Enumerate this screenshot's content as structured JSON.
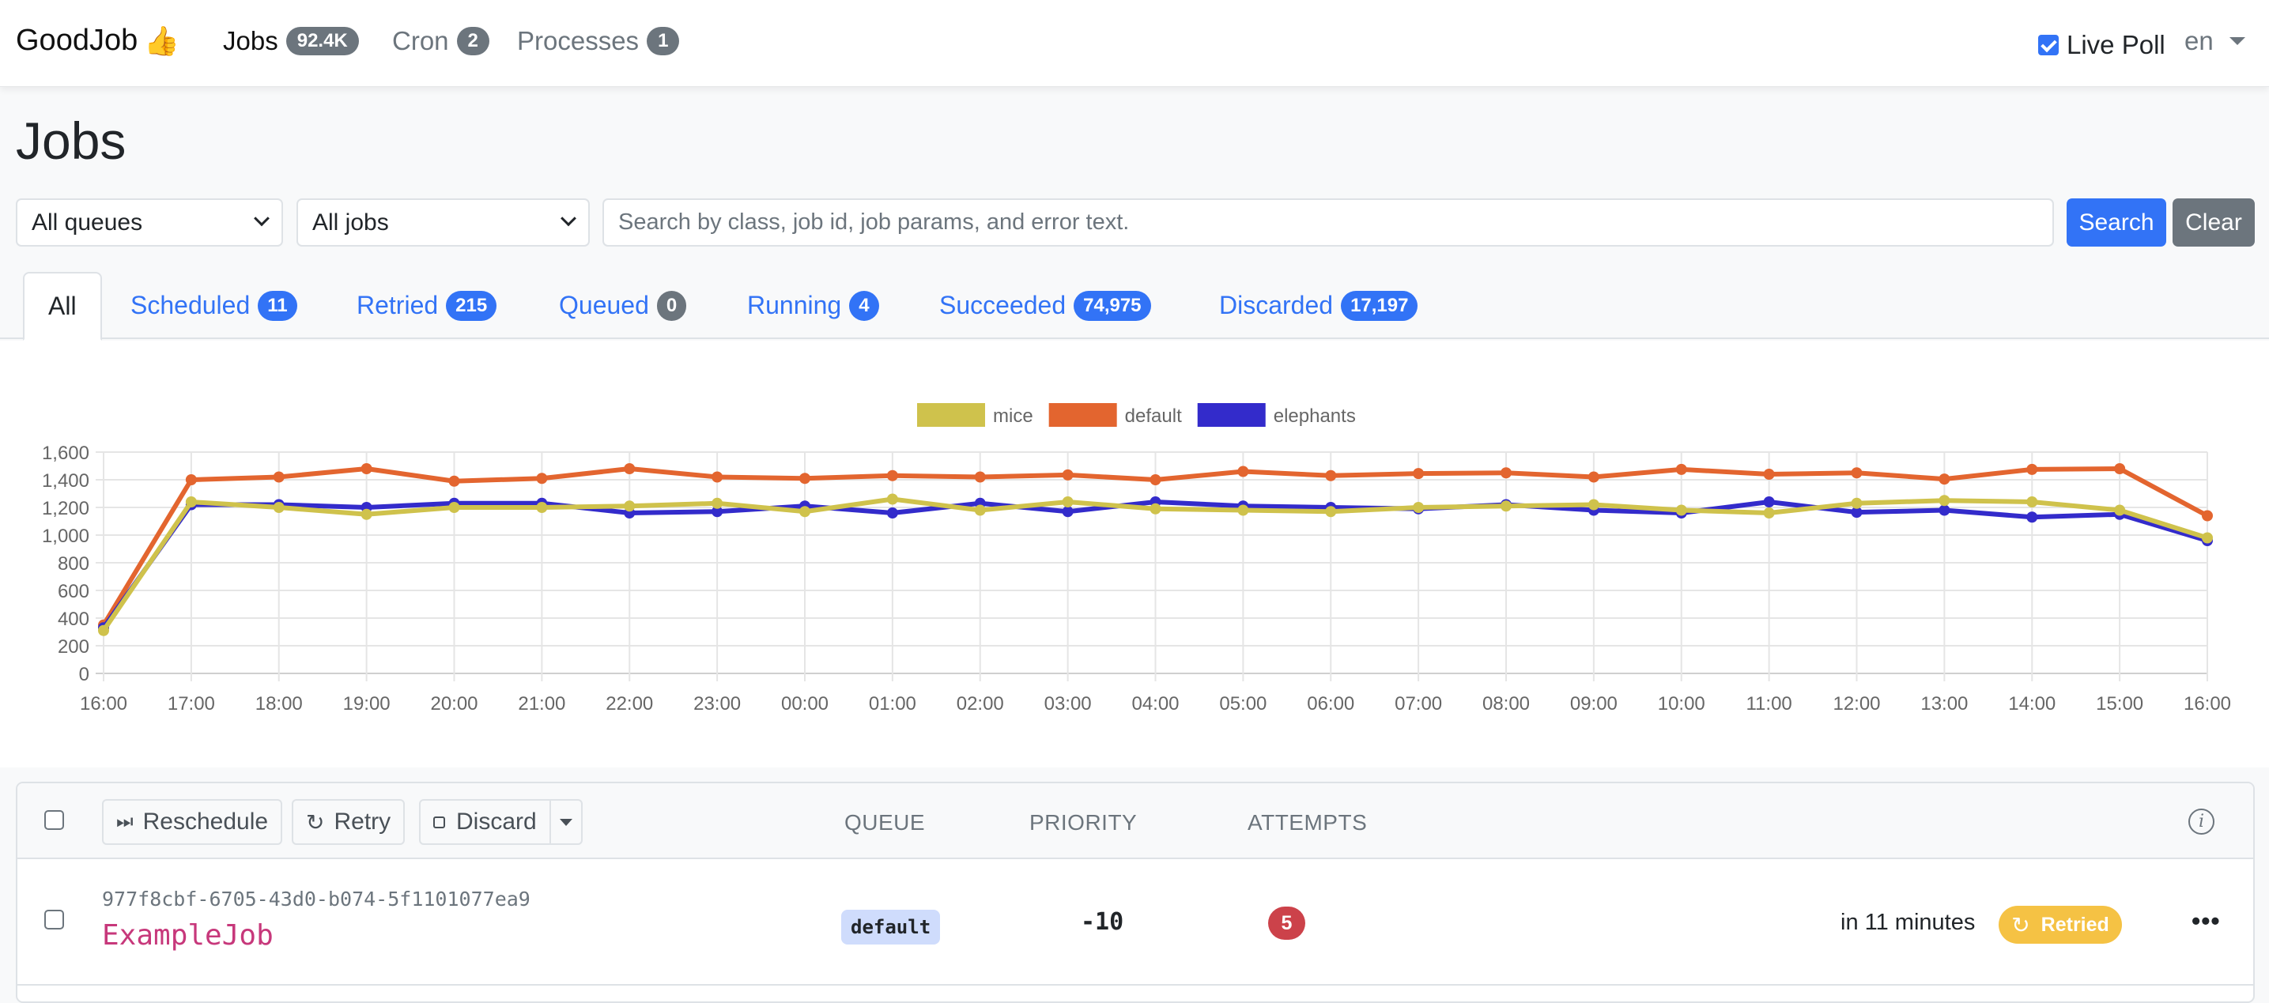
{
  "navbar": {
    "brand": "GoodJob",
    "brand_icon": "👍",
    "items": [
      {
        "label": "Jobs",
        "badge": "92.4K",
        "active": true
      },
      {
        "label": "Cron",
        "badge": "2",
        "active": false
      },
      {
        "label": "Processes",
        "badge": "1",
        "active": false
      }
    ],
    "live_poll": {
      "label": "Live Poll",
      "checked": true
    },
    "locale": "en"
  },
  "page": {
    "title": "Jobs"
  },
  "filters": {
    "queue_select": "All queues",
    "job_select": "All jobs",
    "search_placeholder": "Search by class, job id, job params, and error text.",
    "search_value": "",
    "search_button": "Search",
    "clear_button": "Clear"
  },
  "tabs": [
    {
      "label": "All",
      "count": null,
      "active": true
    },
    {
      "label": "Scheduled",
      "count": "11"
    },
    {
      "label": "Retried",
      "count": "215"
    },
    {
      "label": "Queued",
      "count": "0"
    },
    {
      "label": "Running",
      "count": "4"
    },
    {
      "label": "Succeeded",
      "count": "74,975"
    },
    {
      "label": "Discarded",
      "count": "17,197"
    }
  ],
  "chart_data": {
    "type": "line",
    "title": "",
    "xlabel": "",
    "ylabel": "",
    "x": [
      "16:00",
      "17:00",
      "18:00",
      "19:00",
      "20:00",
      "21:00",
      "22:00",
      "23:00",
      "00:00",
      "01:00",
      "02:00",
      "03:00",
      "04:00",
      "05:00",
      "06:00",
      "07:00",
      "08:00",
      "09:00",
      "10:00",
      "11:00",
      "12:00",
      "13:00",
      "14:00",
      "15:00",
      "16:00"
    ],
    "ylim": [
      0,
      1600
    ],
    "yticks": [
      0,
      200,
      400,
      600,
      800,
      1000,
      1200,
      1400,
      1600
    ],
    "ytick_labels": [
      "0",
      "200",
      "400",
      "600",
      "800",
      "1,000",
      "1,200",
      "1,400",
      "1,600"
    ],
    "grid": true,
    "legend_position": "top",
    "series": [
      {
        "name": "mice",
        "color": "#cfc24c",
        "values": [
          310,
          1240,
          1200,
          1150,
          1200,
          1200,
          1210,
          1230,
          1170,
          1260,
          1180,
          1240,
          1190,
          1180,
          1170,
          1200,
          1210,
          1220,
          1180,
          1160,
          1230,
          1250,
          1240,
          1180,
          980
        ]
      },
      {
        "name": "default",
        "color": "#e3652f",
        "values": [
          350,
          1400,
          1420,
          1480,
          1390,
          1410,
          1480,
          1420,
          1410,
          1430,
          1420,
          1435,
          1400,
          1460,
          1430,
          1445,
          1450,
          1420,
          1475,
          1440,
          1450,
          1405,
          1475,
          1480,
          1140
        ]
      },
      {
        "name": "elephants",
        "color": "#332bcb",
        "values": [
          330,
          1220,
          1220,
          1200,
          1230,
          1230,
          1160,
          1170,
          1210,
          1160,
          1230,
          1170,
          1240,
          1210,
          1200,
          1190,
          1220,
          1180,
          1160,
          1240,
          1165,
          1180,
          1130,
          1150,
          960
        ]
      }
    ]
  },
  "table": {
    "actions": {
      "reschedule": "Reschedule",
      "retry": "Retry",
      "discard": "Discard"
    },
    "columns": {
      "queue": "QUEUE",
      "priority": "PRIORITY",
      "attempts": "ATTEMPTS"
    },
    "rows": [
      {
        "id": "977f8cbf-6705-43d0-b074-5f1101077ea9",
        "job_class": "ExampleJob",
        "queue": "default",
        "priority": "-10",
        "attempts": "5",
        "scheduled": "in 11 minutes",
        "status": "Retried"
      }
    ]
  }
}
